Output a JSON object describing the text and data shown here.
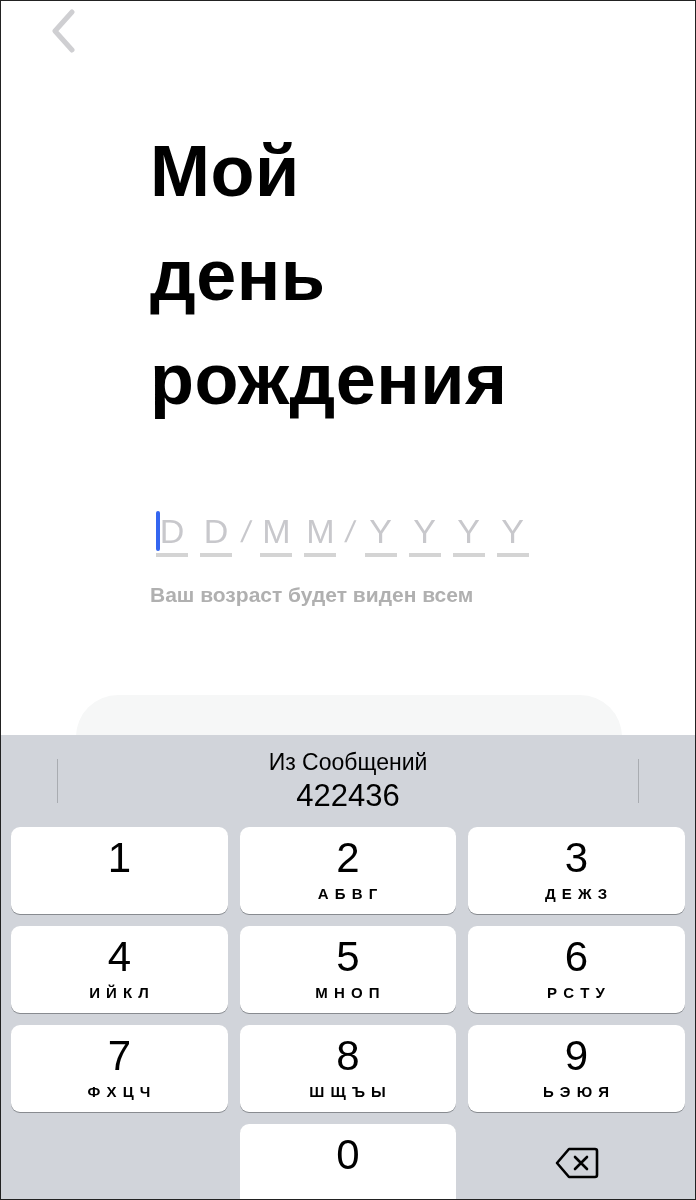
{
  "back_button": {
    "kind": "chevron"
  },
  "title": [
    "Мой",
    "день",
    "рождения"
  ],
  "date_field": {
    "slots": [
      {
        "kind": "digit",
        "placeholder": "D",
        "focused": true
      },
      {
        "kind": "digit",
        "placeholder": "D",
        "focused": false
      },
      {
        "kind": "separator",
        "text": "/"
      },
      {
        "kind": "digit",
        "placeholder": "M",
        "focused": false
      },
      {
        "kind": "digit",
        "placeholder": "M",
        "focused": false
      },
      {
        "kind": "separator",
        "text": "/"
      },
      {
        "kind": "digit",
        "placeholder": "Y",
        "focused": false
      },
      {
        "kind": "digit",
        "placeholder": "Y",
        "focused": false
      },
      {
        "kind": "digit",
        "placeholder": "Y",
        "focused": false
      },
      {
        "kind": "digit",
        "placeholder": "Y",
        "focused": false
      }
    ]
  },
  "hint": "Ваш возраст будет виден всем",
  "continue_button": {
    "disabled": true
  },
  "keyboard": {
    "suggestion": {
      "source": "Из Сообщений",
      "code": "422436"
    },
    "keys": [
      {
        "kind": "digit",
        "digit": "1"
      },
      {
        "kind": "digit",
        "digit": "2",
        "letters": "А Б В Г"
      },
      {
        "kind": "digit",
        "digit": "3",
        "letters": "Д Е Ж З"
      },
      {
        "kind": "digit",
        "digit": "4",
        "letters": "И Й К Л"
      },
      {
        "kind": "digit",
        "digit": "5",
        "letters": "М Н О П"
      },
      {
        "kind": "digit",
        "digit": "6",
        "letters": "Р С Т У"
      },
      {
        "kind": "digit",
        "digit": "7",
        "letters": "Ф Х Ц Ч"
      },
      {
        "kind": "digit",
        "digit": "8",
        "letters": "Ш Щ Ъ Ы"
      },
      {
        "kind": "digit",
        "digit": "9",
        "letters": "Ь Э Ю Я"
      },
      {
        "kind": "empty"
      },
      {
        "kind": "digit",
        "digit": "0"
      },
      {
        "kind": "delete"
      }
    ]
  }
}
